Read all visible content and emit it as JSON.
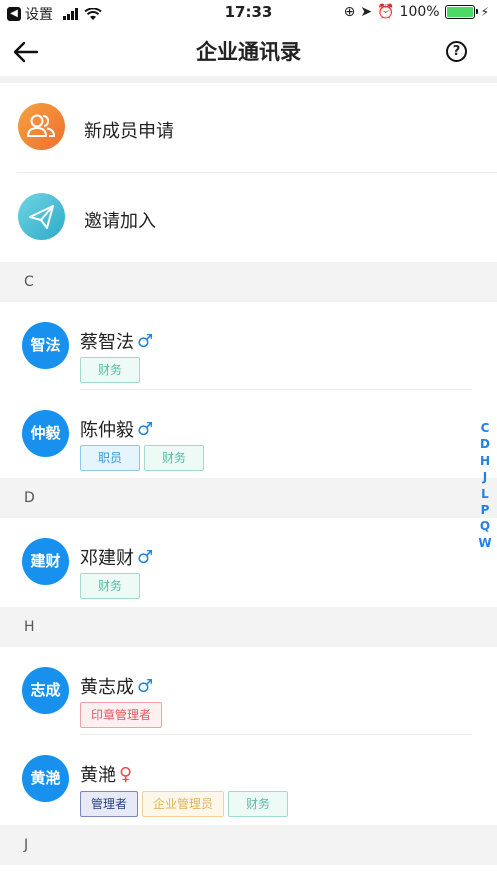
{
  "status_bar": {
    "back_app_label": "设置",
    "time": "17:33",
    "battery": "100%"
  },
  "nav": {
    "title": "企业通讯录",
    "help_symbol": "?"
  },
  "actions": [
    {
      "label": "新成员申请",
      "icon": "people-icon",
      "color": "#f08a36"
    },
    {
      "label": "邀请加入",
      "icon": "paper-plane-icon",
      "color": "#4fc4d8"
    }
  ],
  "sections": [
    {
      "letter": "C",
      "contacts": [
        {
          "initials": "智法",
          "name": "蔡智法",
          "gender": "♂",
          "tags": [
            "财务"
          ]
        },
        {
          "initials": "仲毅",
          "name": "陈仲毅",
          "gender": "♂",
          "tags": [
            "职员",
            "财务"
          ]
        }
      ]
    },
    {
      "letter": "D",
      "contacts": [
        {
          "initials": "建财",
          "name": "邓建财",
          "gender": "♂",
          "tags": [
            "财务"
          ]
        }
      ]
    },
    {
      "letter": "H",
      "contacts": [
        {
          "initials": "志成",
          "name": "黄志成",
          "gender": "♂",
          "tags": [
            "印章管理者"
          ]
        },
        {
          "initials": "黄滟",
          "name": "黄滟",
          "gender": "♀",
          "tags": [
            "管理者",
            "企业管理员",
            "财务"
          ]
        }
      ]
    },
    {
      "letter": "J",
      "contacts": []
    }
  ],
  "index_letters": [
    "C",
    "D",
    "H",
    "J",
    "L",
    "P",
    "Q",
    "W"
  ],
  "colors": {
    "accent": "#1790ee",
    "male": "#1d84e6",
    "female": "#ea4a50"
  }
}
